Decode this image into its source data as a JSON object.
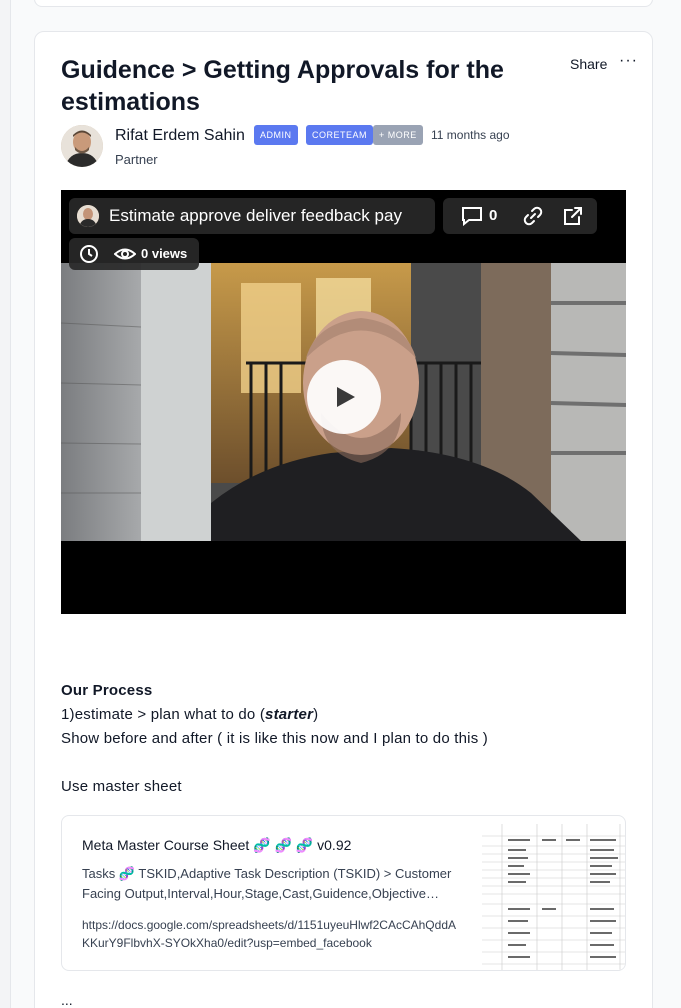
{
  "post": {
    "title": "Guidence > Getting Approvals for the estimations",
    "share_label": "Share",
    "more_label": "···",
    "author": {
      "name": "Rifat Erdem Sahin",
      "role": "Partner",
      "badges": [
        "ADMIN",
        "CORETEAM",
        "+ MORE"
      ],
      "timeago": "11 months ago"
    },
    "video": {
      "title": "Estimate approve deliver feedback pay",
      "comment_count": "0",
      "views_label": "0 views"
    },
    "content": {
      "heading": "Our Process",
      "line1_prefix": "1)estimate > plan what to do  (",
      "line1_emph": "starter",
      "line1_suffix": ")",
      "line2": "Show before and after ( it is like this now and I plan to do this )",
      "line3": "Use master sheet"
    },
    "link_preview": {
      "title": "Meta Master Course Sheet 🧬 🧬 🧬 v0.92",
      "description": "Tasks 🧬 TSKID,Adaptive Task Description (TSKID) > Customer Facing Output,Interval,Hour,Stage,Cast,Guidence,Objective…",
      "url": "https://docs.google.com/spreadsheets/d/1151uyeuHlwf2CAcCAhQddAKKurY9FlbvhX-SYOkXha0/edit?usp=embed_facebook"
    },
    "ellipsis": "..."
  },
  "colors": {
    "badge_primary": "#5b79f0",
    "badge_more": "#9aa3b4"
  },
  "icons": [
    "play-icon",
    "comment-icon",
    "link-icon",
    "external-link-icon",
    "clock-icon",
    "eye-icon",
    "more-icon"
  ]
}
